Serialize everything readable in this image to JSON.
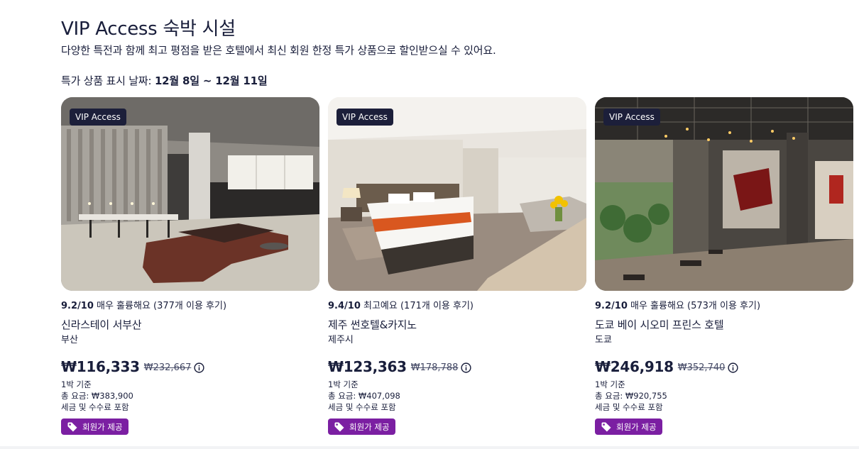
{
  "section": {
    "title": "VIP Access 숙박 시설",
    "subtitle": "다양한 특전과 함께 최고 평점을 받은 호텔에서 최신 회원 한정 특가 상품으로 할인받으실 수 있어요.",
    "dates_label": "특가 상품 표시 날짜: ",
    "dates_value": "12월 8일 ~ 12월 11일"
  },
  "cards": [
    {
      "badge": "VIP Access",
      "score": "9.2/10",
      "rating_text": " 매우 훌륭해요 (377개 이용 후기)",
      "name": "신라스테이 서부산",
      "city": "부산",
      "price": "₩116,333",
      "old_price": "₩232,667",
      "per_night": "1박 기준",
      "total": "총 요금: ₩383,900",
      "tax_note": "세금 및 수수료 포함",
      "member_tag": "회원가 제공"
    },
    {
      "badge": "VIP Access",
      "score": "9.4/10",
      "rating_text": " 최고예요 (171개 이용 후기)",
      "name": "제주 썬호텔&카지노",
      "city": "제주시",
      "price": "₩123,363",
      "old_price": "₩178,788",
      "per_night": "1박 기준",
      "total": "총 요금: ₩407,098",
      "tax_note": "세금 및 수수료 포함",
      "member_tag": "회원가 제공"
    },
    {
      "badge": "VIP Access",
      "score": "9.2/10",
      "rating_text": " 매우 훌륭해요 (573개 이용 후기)",
      "name": "도쿄 베이 시오미 프린스 호텔",
      "city": "도쿄",
      "price": "₩246,918",
      "old_price": "₩352,740",
      "per_night": "1박 기준",
      "total": "총 요금: ₩920,755",
      "tax_note": "세금 및 수수료 포함",
      "member_tag": "회원가 제공"
    }
  ],
  "icons": {
    "price_info": "info-circle-icon",
    "member_tag": "tag-icon"
  },
  "colors": {
    "badge_dark": "#1c1f3a",
    "member_tag": "#7b1fa2",
    "text": "#191e3b"
  }
}
